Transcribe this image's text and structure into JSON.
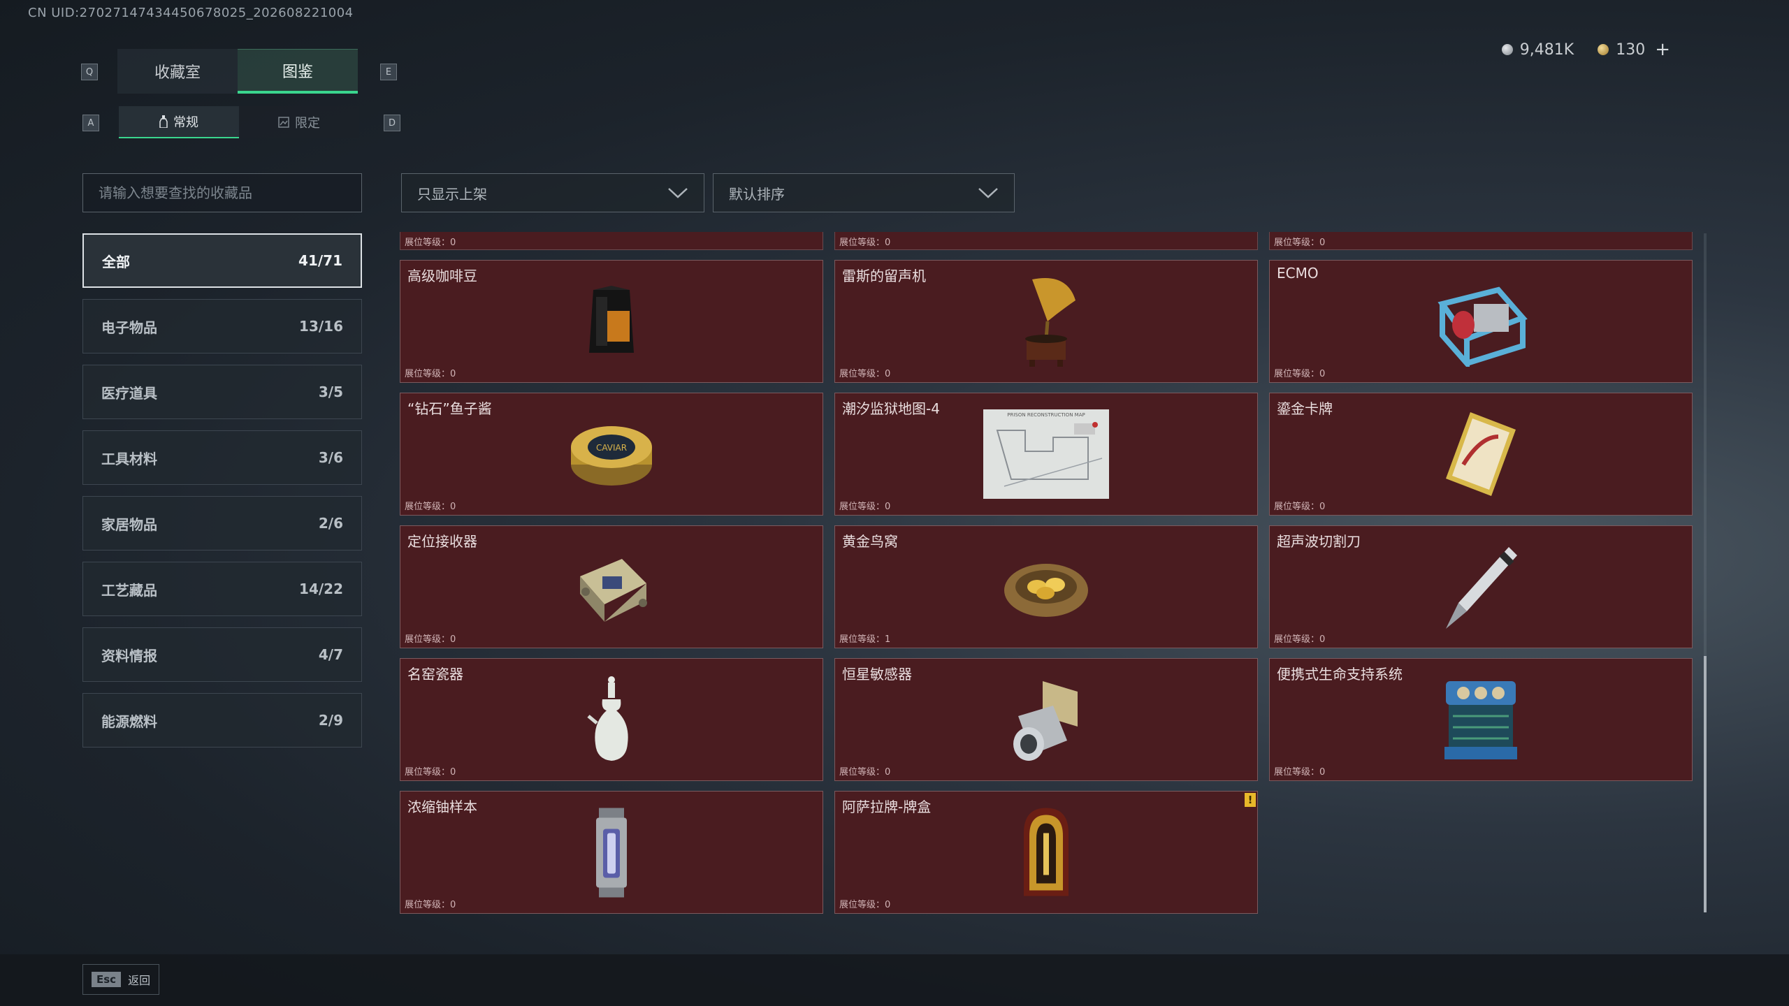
{
  "uid": "CN UID:270271474344506780​25_202608221004",
  "currency": {
    "silver": "9,481K",
    "gold": "130",
    "plus": "+"
  },
  "keys": {
    "prev_tab": "Q",
    "next_tab": "E",
    "prev_sub": "A",
    "next_sub": "D"
  },
  "tabs": [
    {
      "label": "收藏室"
    },
    {
      "label": "图鉴"
    }
  ],
  "subtabs": [
    {
      "label": "常规"
    },
    {
      "label": "限定"
    }
  ],
  "search": {
    "placeholder": "请输入想要查找的收藏品"
  },
  "filters": {
    "shelf": "只显示上架",
    "sort": "默认排序"
  },
  "categories": [
    {
      "name": "全部",
      "count": "41/71"
    },
    {
      "name": "电子物品",
      "count": "13/16"
    },
    {
      "name": "医疗道具",
      "count": "3/5"
    },
    {
      "name": "工具材料",
      "count": "3/6"
    },
    {
      "name": "家居物品",
      "count": "2/6"
    },
    {
      "name": "工艺藏品",
      "count": "14/22"
    },
    {
      "name": "资料情报",
      "count": "4/7"
    },
    {
      "name": "能源燃料",
      "count": "2/9"
    }
  ],
  "partial_row": [
    {
      "level": "展位等级：0"
    },
    {
      "level": "展位等级：0"
    },
    {
      "level": "展位等级：0"
    }
  ],
  "items": [
    {
      "name": "高级咖啡豆",
      "level": "展位等级：0"
    },
    {
      "name": "雷斯的留声机",
      "level": "展位等级：0"
    },
    {
      "name": "ECMO",
      "level": "展位等级：0"
    },
    {
      "name": "“钻石”鱼子酱",
      "level": "展位等级：0"
    },
    {
      "name": "潮汐监狱地图-4",
      "level": "展位等级：0"
    },
    {
      "name": "鎏金卡牌",
      "level": "展位等级：0"
    },
    {
      "name": "定位接收器",
      "level": "展位等级：0"
    },
    {
      "name": "黄金鸟窝",
      "level": "展位等级：1"
    },
    {
      "name": "超声波切割刀",
      "level": "展位等级：0"
    },
    {
      "name": "名窑瓷器",
      "level": "展位等级：0"
    },
    {
      "name": "恒星敏感器",
      "level": "展位等级：0"
    },
    {
      "name": "便携式生命支持系统",
      "level": "展位等级：0"
    },
    {
      "name": "浓缩铀样本",
      "level": "展位等级：0"
    },
    {
      "name": "阿萨拉牌-牌盒",
      "level": "展位等级：0",
      "warning": "!"
    }
  ],
  "map_caption": "PRISON RECONSTRUCTION MAP",
  "caviar_label": "CAVIAR",
  "footer": {
    "key": "Esc",
    "label": "返回"
  },
  "colors": {
    "accent": "#3ad68e",
    "card_bg": "#4a1c20",
    "warning": "#e8b82a"
  }
}
